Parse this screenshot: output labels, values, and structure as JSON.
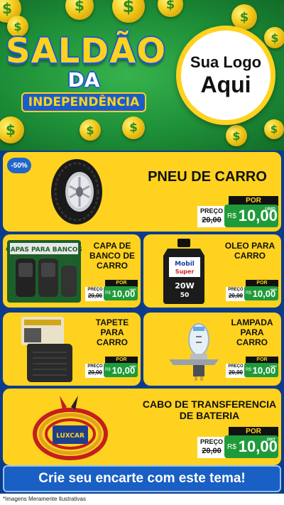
{
  "header": {
    "title_line1": "SALDÃO",
    "title_line2": "DA",
    "title_line3": "INDEPENDÊNCIA",
    "logo_line1": "Sua Logo",
    "logo_line2": "Aqui",
    "coin_symbol": "$"
  },
  "colors": {
    "brand_yellow": "#ffd21f",
    "brand_blue": "#1b5dc8",
    "price_green": "#1f9a3a",
    "header_green": "#1e8f38"
  },
  "products": [
    {
      "name": "PNEU DE CARRO",
      "badge": "-50%",
      "por_label": "POR",
      "old_label": "PREÇO",
      "old_prefix": "R$",
      "old_price": "20,00",
      "currency": "R$",
      "price": "10,00",
      "unit": "UNID",
      "image": "tire-icon"
    },
    {
      "name": "CAPA DE BANCO DE CARRO",
      "por_label": "POR",
      "old_label": "PREÇO",
      "old_prefix": "R$",
      "old_price": "20,00",
      "currency": "R$",
      "price": "10,00",
      "unit": "UNID",
      "image": "seat-cover-icon",
      "package_text": "CAPAS PARA BANCOS"
    },
    {
      "name": "OLEO PARA CARRO",
      "por_label": "POR",
      "old_label": "PREÇO",
      "old_prefix": "R$",
      "old_price": "20,00",
      "currency": "R$",
      "price": "10,00",
      "unit": "UNID",
      "image": "oil-bottle-icon",
      "package_text": "Mobil Super 20W 50"
    },
    {
      "name": "TAPETE PARA CARRO",
      "por_label": "POR",
      "old_label": "PREÇO",
      "old_prefix": "R$",
      "old_price": "20,00",
      "currency": "R$",
      "price": "10,00",
      "unit": "UNID",
      "image": "car-mat-icon"
    },
    {
      "name": "LAMPADA PARA CARRO",
      "por_label": "POR",
      "old_label": "PREÇO",
      "old_prefix": "R$",
      "old_price": "20,00",
      "currency": "R$",
      "price": "10,00",
      "unit": "UNID",
      "image": "headlight-bulb-icon"
    },
    {
      "name": "CABO DE TRANSFERENCIA DE BATERIA",
      "por_label": "POR",
      "old_label": "PREÇO",
      "old_prefix": "R$",
      "old_price": "20,00",
      "currency": "R$",
      "price": "10,00",
      "unit": "PRT",
      "image": "jumper-cable-icon",
      "package_text": "LUXCAR"
    }
  ],
  "cta": "Crie seu encarte com este tema!",
  "footer": "*Imagens Meramente Ilustrativas"
}
